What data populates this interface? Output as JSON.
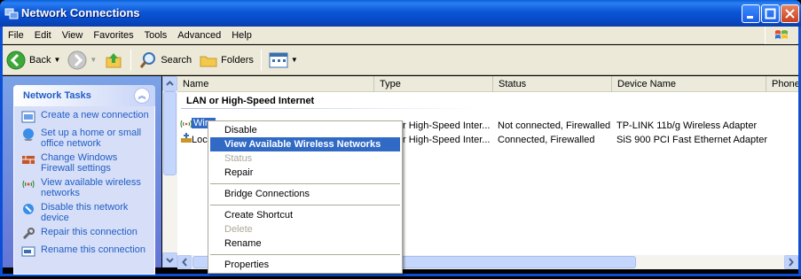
{
  "window": {
    "title": "Network Connections"
  },
  "menubar": [
    "File",
    "Edit",
    "View",
    "Favorites",
    "Tools",
    "Advanced",
    "Help"
  ],
  "toolbar": {
    "back": "Back",
    "search": "Search",
    "folders": "Folders"
  },
  "task_pane": {
    "header": "Network Tasks",
    "tasks": [
      "Create a new connection",
      "Set up a home or small office network",
      "Change Windows Firewall settings",
      "View available wireless networks",
      "Disable this network device",
      "Repair this connection",
      "Rename this connection"
    ]
  },
  "list": {
    "columns": [
      "Name",
      "Type",
      "Status",
      "Device Name",
      "Phone #"
    ],
    "group": "LAN or High-Speed Internet",
    "rows": [
      {
        "name": "Wire",
        "type": "r High-Speed Inter...",
        "status": "Not connected, Firewalled",
        "device": "TP-LINK 11b/g Wireless Adapter"
      },
      {
        "name": "Loca",
        "type": "r High-Speed Inter...",
        "status": "Connected, Firewalled",
        "device": "SiS 900 PCI Fast Ethernet Adapter"
      }
    ]
  },
  "context_menu": {
    "items": [
      "Disable",
      "View Available Wireless Networks",
      "Status",
      "Repair",
      "Bridge Connections",
      "Create Shortcut",
      "Delete",
      "Rename",
      "Properties"
    ]
  },
  "colors": {
    "title_bar": "#0b56d6",
    "selection": "#316ac5",
    "task_link": "#215dc6"
  }
}
